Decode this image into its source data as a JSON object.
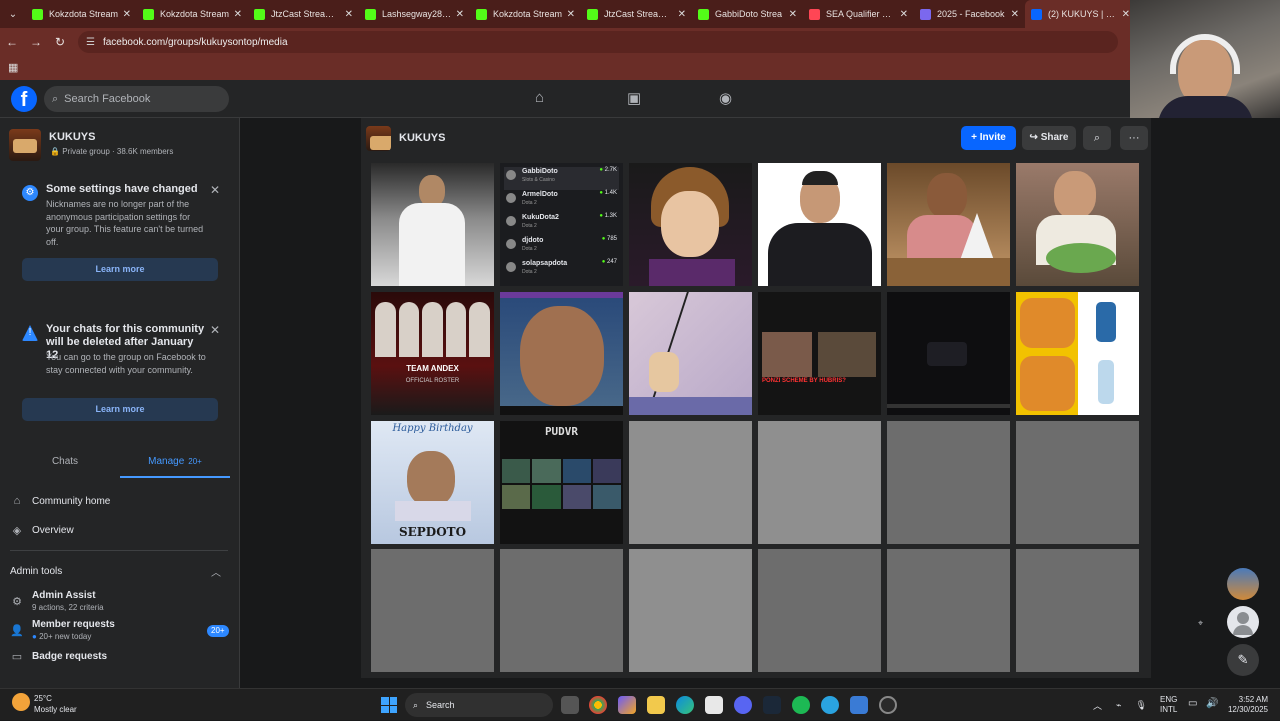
{
  "browser": {
    "tabs": [
      {
        "label": "Kokzdota Stream",
        "color": "#53fc18"
      },
      {
        "label": "Kokzdota Stream",
        "color": "#53fc18"
      },
      {
        "label": "JtzCast Stream - V",
        "color": "#53fc18"
      },
      {
        "label": "Lashsegway28 Str",
        "color": "#53fc18"
      },
      {
        "label": "Kokzdota Stream",
        "color": "#53fc18"
      },
      {
        "label": "JtzCast Stream - V",
        "color": "#53fc18"
      },
      {
        "label": "GabbiDoto Strea",
        "color": "#53fc18"
      },
      {
        "label": "SEA Qualifier 1 - F",
        "color": "#ff4655"
      },
      {
        "label": "2025 - Facebook",
        "color": "#7b68ee"
      },
      {
        "label": "(2) KUKUYS | Face",
        "color": "#0866ff"
      }
    ],
    "url": "facebook.com/groups/kukuysontop/media"
  },
  "fb": {
    "search_placeholder": "Search Facebook"
  },
  "sidebar": {
    "group_name": "KUKUYS",
    "group_meta": "Private group · 38.6K members",
    "notice1": {
      "title": "Some settings have changed",
      "body": "Nicknames are no longer part of the anonymous participation settings for your group. This feature can't be turned off.",
      "button": "Learn more"
    },
    "notice2": {
      "title": "Your chats for this community will be deleted after January 12",
      "body": "You can go to the group on Facebook to stay connected with your community.",
      "button": "Learn more"
    },
    "tab_chats": "Chats",
    "tab_manage": "Manage",
    "tab_manage_count": "20+",
    "community_home": "Community home",
    "overview": "Overview",
    "admin_tools": "Admin tools",
    "admin_assist": "Admin Assist",
    "admin_assist_sub": "9 actions, 22 criteria",
    "member_requests": "Member requests",
    "member_requests_sub": "20+ new today",
    "member_requests_badge": "20+",
    "badge_requests": "Badge requests"
  },
  "main": {
    "group_name": "KUKUYS",
    "invite": "Invite",
    "share": "Share"
  },
  "media": {
    "thumb2": {
      "rows": [
        {
          "name": "GabbiDoto",
          "sub": "Slots & Casino",
          "val": "2.7K"
        },
        {
          "name": "ArmelDoto",
          "sub": "Dota 2",
          "val": "1.4K"
        },
        {
          "name": "KukuDota2",
          "sub": "Dota 2",
          "val": "1.3K"
        },
        {
          "name": "djdoto",
          "sub": "Dota 2",
          "val": "785"
        },
        {
          "name": "solapsapdota",
          "sub": "Dota 2",
          "val": "247"
        }
      ]
    },
    "thumb7_caption": "TEAM ANDEX",
    "thumb7_sub": "OFFICIAL ROSTER",
    "thumb10_caption": "PONZI SCHEME BY HUBRIS?",
    "thumb13_top": "Happy Birthday",
    "thumb13_name": "SEPDOTO",
    "thumb14_caption": "PUDVR"
  },
  "taskbar": {
    "temp": "25°C",
    "weather": "Mostly clear",
    "search": "Search",
    "lang1": "ENG",
    "lang2": "INTL",
    "time": "3:52 AM",
    "date": "12/30/2025"
  }
}
